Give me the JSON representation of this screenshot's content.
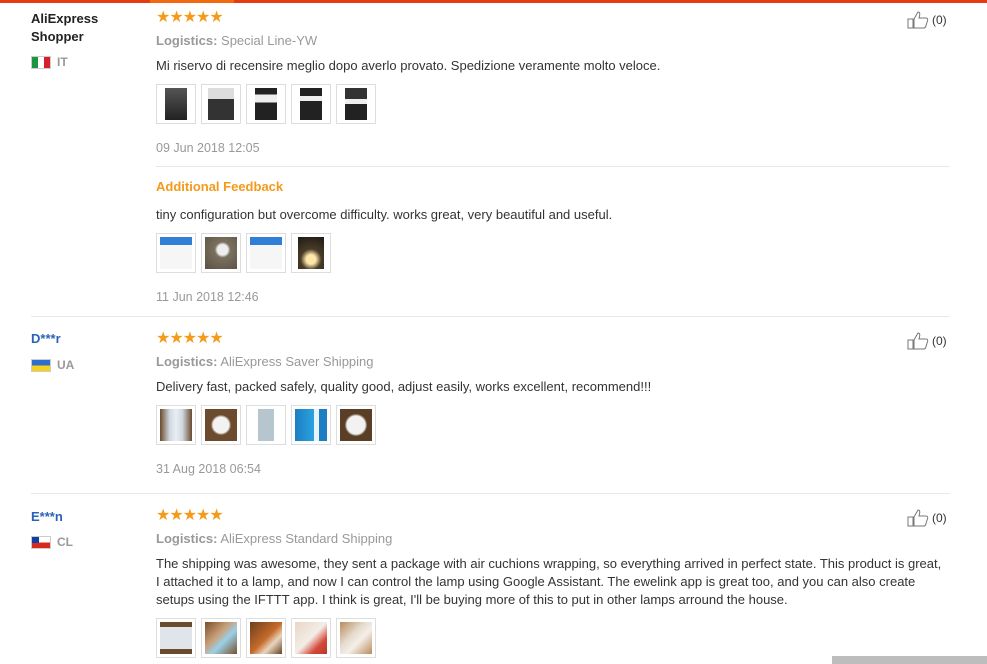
{
  "reviews": [
    {
      "user": "AliExpress Shopper",
      "country": "IT",
      "logistics_label": "Logistics:",
      "logistics_value": "Special Line-YW",
      "text": "Mi riservo di recensire meglio dopo averlo provato. Spedizione veramente molto veloce.",
      "date": "09 Jun 2018 12:05",
      "helpful": "(0)",
      "additional_feedback_label": "Additional Feedback",
      "additional_text": "tiny configuration but overcome difficulty. works great, very beautiful and useful.",
      "additional_date": "11 Jun 2018 12:46"
    },
    {
      "user": "D***r",
      "country": "UA",
      "logistics_label": "Logistics:",
      "logistics_value": "AliExpress Saver Shipping",
      "text": "Delivery fast, packed safely, quality good, adjust easily, works excellent, recommend!!!",
      "date": "31 Aug 2018 06:54",
      "helpful": "(0)"
    },
    {
      "user": "E***n",
      "country": "CL",
      "logistics_label": "Logistics:",
      "logistics_value": "AliExpress Standard Shipping",
      "text": "The shipping was awesome, they sent a package with air cuchions wrapping, so everything arrived in perfect state. This product is great, I attached it to a lamp, and now I can control the lamp using Google Assistant. The ewelink app is great too, and you can also create setups using the IFTTT app. I think is great, I'll be buying more of this to put in other lamps arround the house.",
      "helpful": "(0)"
    }
  ],
  "stars": "★★★★★",
  "colors": {
    "accent": "#e53a12",
    "star": "#f59b1b",
    "user_link": "#2a62b8",
    "additional": "#f39a1b"
  }
}
